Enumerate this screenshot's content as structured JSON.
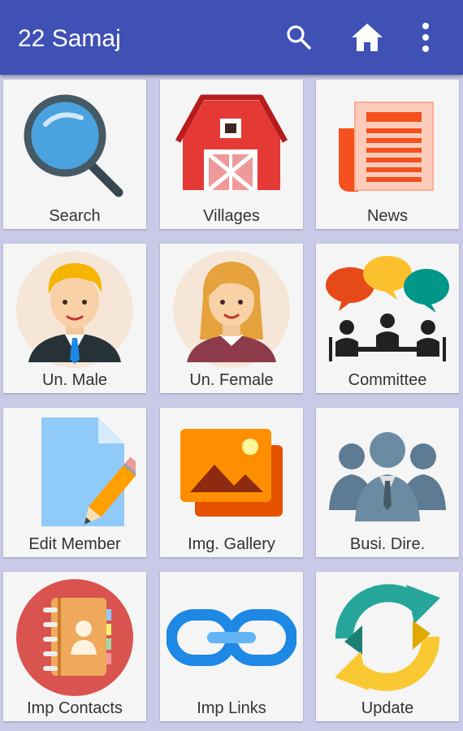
{
  "app": {
    "title": "22 Samaj"
  },
  "toolbar": {
    "search_icon": "search-icon",
    "home_icon": "home-icon",
    "more_icon": "more-vert-icon"
  },
  "tiles": [
    {
      "label": "Search",
      "icon": "magnifier-icon"
    },
    {
      "label": "Villages",
      "icon": "barn-icon"
    },
    {
      "label": "News",
      "icon": "newspaper-icon"
    },
    {
      "label": "Un. Male",
      "icon": "male-avatar-icon"
    },
    {
      "label": "Un. Female",
      "icon": "female-avatar-icon"
    },
    {
      "label": "Committee",
      "icon": "committee-icon"
    },
    {
      "label": "Edit Member",
      "icon": "edit-document-icon"
    },
    {
      "label": "Img. Gallery",
      "icon": "image-gallery-icon"
    },
    {
      "label": "Busi. Dire.",
      "icon": "business-people-icon"
    },
    {
      "label": "Imp Contacts",
      "icon": "contacts-book-icon"
    },
    {
      "label": "Imp Links",
      "icon": "link-chain-icon"
    },
    {
      "label": "Update",
      "icon": "refresh-arrows-icon"
    }
  ],
  "colors": {
    "appbar": "#3f51b5",
    "background": "#c8cae8",
    "tile": "#f5f5f5"
  }
}
